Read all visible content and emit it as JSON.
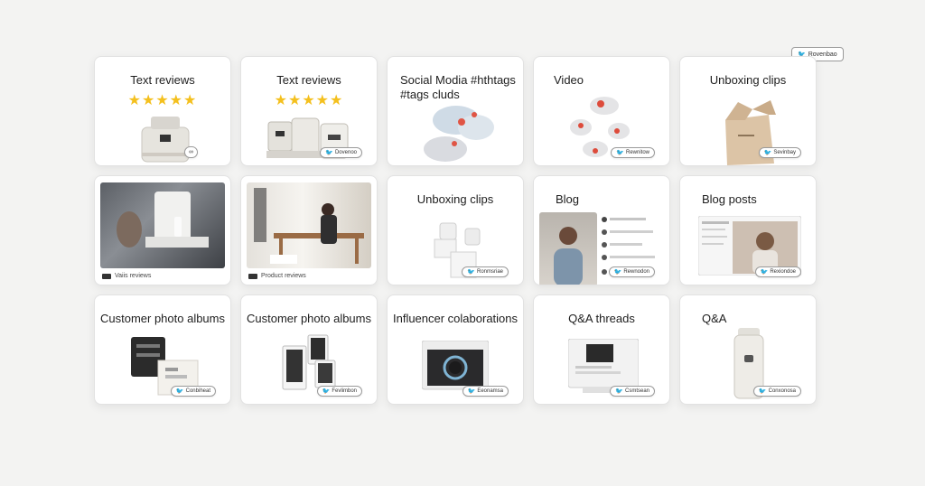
{
  "top_badge": {
    "label": "Rovenbao",
    "icon": "bird-icon"
  },
  "cards": [
    {
      "title": "Text reviews",
      "stars": "★★★★★",
      "badge": ""
    },
    {
      "title": "Text reviews",
      "stars": "★★★★★",
      "badge": "Dovenoo"
    },
    {
      "title": "Social Modia #hthtags #tags cluds",
      "badge": ""
    },
    {
      "title": "Video",
      "badge": "Rewnitow"
    },
    {
      "title": "Unboxing clips",
      "badge": "Sevinbay"
    },
    {
      "caption": "Vaiis reviews"
    },
    {
      "caption": "Product reviews"
    },
    {
      "title": "Unboxing clips",
      "badge": "Ronmsriae"
    },
    {
      "title": "Blog",
      "badge": "Rewnodon"
    },
    {
      "title": "Blog posts",
      "badge": "Rexiondoe"
    },
    {
      "title": "Customer photo albums",
      "badge": "Conbiheat"
    },
    {
      "title": "Customer photo albums",
      "badge": "Fevlimbon"
    },
    {
      "title": "Influencer colaborations",
      "badge": "Eeonamsa"
    },
    {
      "title": "Q&A threads",
      "badge": "Csmtsean"
    },
    {
      "title": "Q&A",
      "badge": "Conxonosa"
    }
  ],
  "colors": {
    "star": "#f4c01e",
    "background": "#f3f3f2",
    "card": "#ffffff"
  }
}
